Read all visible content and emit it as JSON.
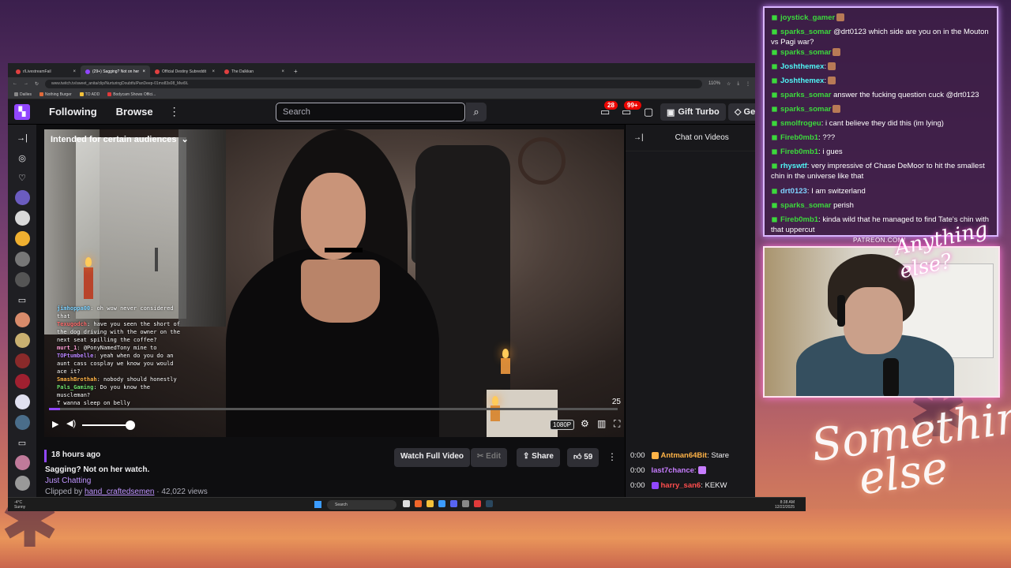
{
  "browser": {
    "tabs": [
      {
        "label": "r/LivestreamFail",
        "active": false
      },
      {
        "label": "(29+) Sagging? Not on her",
        "active": true
      },
      {
        "label": "Official Destiny Subreddit",
        "active": false
      },
      {
        "label": "The Dalkkan",
        "active": false
      }
    ],
    "new_tab": "+",
    "url": "www.twitch.tv/sweet_anita/clip/NurturingDoubtfulPanDeep-01mo83s08_Mwi9L",
    "zoom": "110%",
    "bookmarks": [
      "Dailies",
      "Nothing Burger",
      "TO ADD",
      "Bodycam Shows Offici..."
    ]
  },
  "twitch": {
    "nav": {
      "following": "Following",
      "browse": "Browse",
      "more": "⋮"
    },
    "search": {
      "placeholder": "Search"
    },
    "notifications_count": "28",
    "whispers_count": "99+",
    "gift_turbo": "Gift Turbo",
    "get_bits": "Get Bits"
  },
  "video": {
    "audience_label": "Intended for certain audiences",
    "timer": "25",
    "quality": "1080P",
    "progress": 0.02,
    "volume": 0.75,
    "chat_overlay": [
      {
        "user": "jimhoppa00",
        "text": ": oh wow never considered that",
        "color": "#7fd3ff"
      },
      {
        "user": "Texugodch",
        "text": ": have you seen the short of the dog driving with the owner on the next seat spilling the coffee?",
        "color": "#ff6b6b"
      },
      {
        "user": "murt_1",
        "text": ": @PonyNamedTony mine to",
        "color": "#ff9dd6"
      },
      {
        "user": "TOPtumbelle",
        "text": ": yeah when do you do an aunt cass cosplay we know you would ace it?",
        "color": "#b784ff"
      },
      {
        "user": "SmashBrothah",
        "text": ": nobody should honestly",
        "color": "#ffb347"
      },
      {
        "user": "Pals_Gaming",
        "text": ": Do you know the muscleman?",
        "color": "#6ee06e"
      },
      {
        "user": "",
        "text": "T wanna sleep on belly",
        "color": "#ccc"
      }
    ]
  },
  "clip": {
    "ago": "18 hours ago",
    "title": "Sagging? Not on her watch.",
    "category": "Just Chatting",
    "clipped_by_prefix": "Clipped by",
    "clipper": "hand_craftedsemen",
    "views": "· 42,022 views",
    "watch_full": "Watch Full Video",
    "edit": "Edit",
    "share": "Share",
    "likes": "59"
  },
  "side_chat": {
    "header": "Chat on Videos",
    "messages": [
      {
        "time": "0:00",
        "user": "Antman64Bit",
        "text": ": Stare",
        "color": "#ffb347"
      },
      {
        "time": "0:00",
        "user": "last7chance",
        "text": ":",
        "color": "#c77dff"
      },
      {
        "time": "0:00",
        "user": "harry_san6",
        "text": ": KEKW",
        "color": "#ff4d4d"
      }
    ]
  },
  "taskbar": {
    "weather_temp": "-4°C",
    "weather_desc": "Sunny",
    "search": "Search",
    "time": "8:38 AM",
    "date": "12/22/2025"
  },
  "stream_chat": [
    {
      "user": "joystick_gamer",
      "text": "",
      "color": "#3cd93c"
    },
    {
      "user": "sparks_somar",
      "text": " @drt0123 which side are you on in the Mouton vs Pagi war?",
      "color": "#3cd93c"
    },
    {
      "user": "sparks_somar",
      "text": "",
      "color": "#3cd93c"
    },
    {
      "user": "Joshthemex",
      "text": ":",
      "color": "#4ff5f5"
    },
    {
      "user": "Joshthemex",
      "text": ":",
      "color": "#4ff5f5"
    },
    {
      "user": "sparks_somar",
      "text": " answer the fucking question cuck @drt0123",
      "color": "#3cd93c"
    },
    {
      "user": "sparks_somar",
      "text": "",
      "color": "#3cd93c"
    },
    {
      "user": "smolfrogeu",
      "text": ": i cant believe they did this (im lying)",
      "color": "#3cd93c"
    },
    {
      "user": "Fireb0mb1",
      "text": ": ???",
      "color": "#3cd93c"
    },
    {
      "user": "Fireb0mb1",
      "text": ": i gues",
      "color": "#3cd93c"
    },
    {
      "user": "rhyswtf",
      "text": ": very impressive of Chase DeMoor to hit the smallest chin in the universe like that",
      "color": "#4ff5f5"
    },
    {
      "user": "drt0123",
      "text": ": I am switzerland",
      "color": "#7fd3ff"
    },
    {
      "user": "sparks_somar",
      "text": " perish",
      "color": "#3cd93c"
    },
    {
      "user": "Fireb0mb1",
      "text": ": kinda wild that he managed to find Tate's chin with that uppercut",
      "color": "#3cd93c"
    }
  ],
  "overlay": {
    "patreon": "PATREON.COM/",
    "brand_small": "Anything else?",
    "brand_large": "Something else"
  },
  "colors": {
    "accent": "#9147ff",
    "alert": "#eb0400"
  }
}
